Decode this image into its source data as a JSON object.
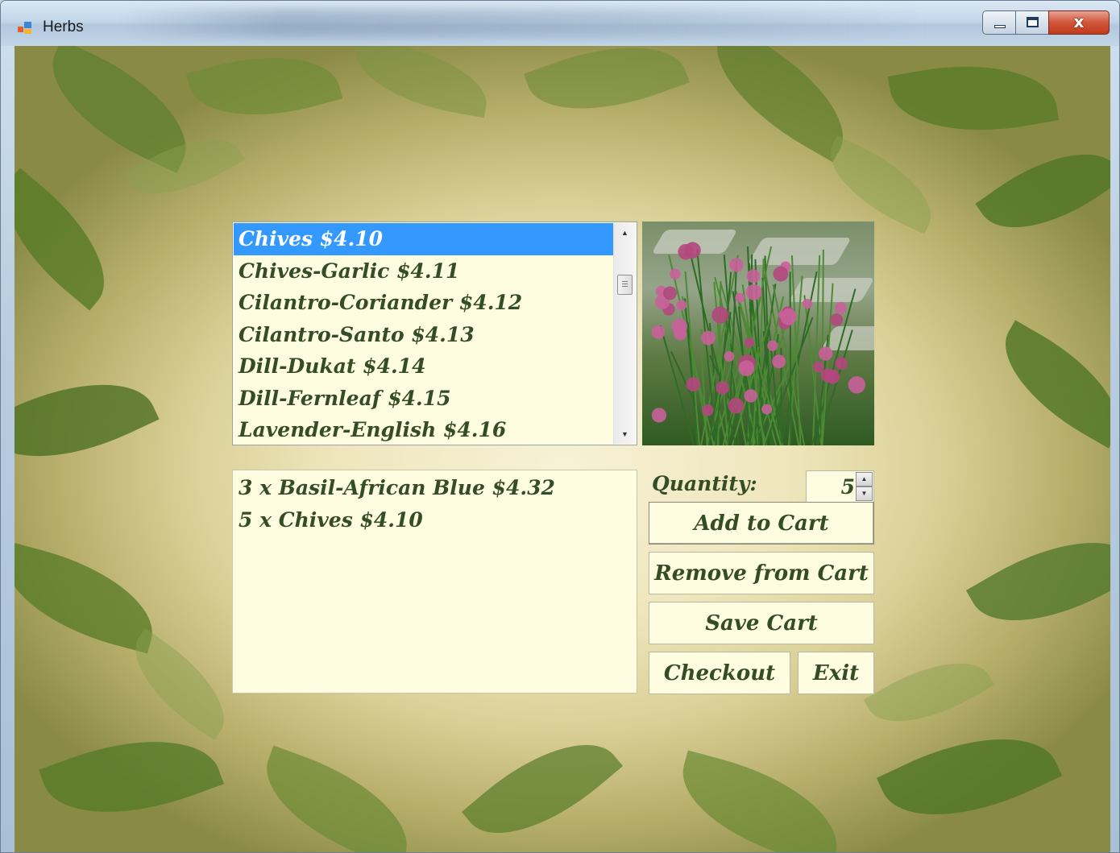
{
  "window": {
    "title": "Herbs",
    "close_glyph": "x",
    "icons": [
      "app-icon",
      "minimize-icon",
      "maximize-icon",
      "close-icon"
    ]
  },
  "herb_list": {
    "selected_index": 0,
    "items": [
      {
        "label": "Chives $4.10"
      },
      {
        "label": "Chives-Garlic $4.11"
      },
      {
        "label": "Cilantro-Coriander $4.12"
      },
      {
        "label": "Cilantro-Santo $4.13"
      },
      {
        "label": "Dill-Dukat $4.14"
      },
      {
        "label": "Dill-Fernleaf $4.15"
      },
      {
        "label": "Lavender-English $4.16"
      }
    ],
    "scroll_up": "▲",
    "scroll_down": "▼"
  },
  "cart": {
    "items": [
      {
        "label": "3 x Basil-African Blue $4.32"
      },
      {
        "label": "5 x Chives $4.10"
      }
    ]
  },
  "quantity": {
    "label": "Quantity:",
    "value": "5",
    "up": "▲",
    "down": "▼"
  },
  "buttons": {
    "add": "Add to Cart",
    "remove": "Remove from Cart",
    "save": "Save Cart",
    "checkout": "Checkout",
    "exit": "Exit"
  },
  "colors": {
    "selection": "#3399ff",
    "text": "#344d25",
    "list_bg": "#fefde2"
  }
}
